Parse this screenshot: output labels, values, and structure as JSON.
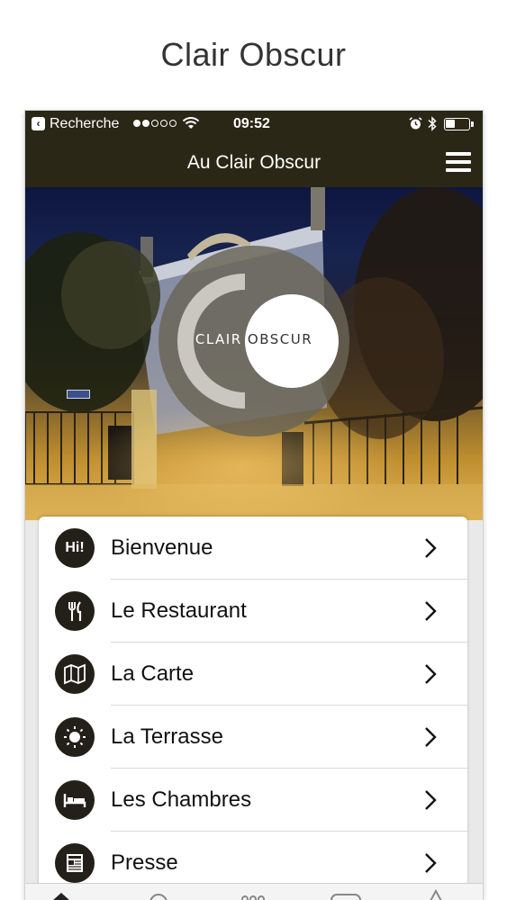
{
  "page": {
    "title": "Clair Obscur"
  },
  "statusbar": {
    "back_label": "Recherche",
    "signal": {
      "filled": 2,
      "total": 5
    },
    "time": "09:52",
    "battery_level": 0.4
  },
  "navbar": {
    "title": "Au Clair Obscur"
  },
  "hero": {
    "logo_text_light": "CLAIR",
    "logo_text_dark": "OBSCUR"
  },
  "menu": {
    "items": [
      {
        "label": "Bienvenue",
        "icon": "hi-icon",
        "icon_text": "Hi!"
      },
      {
        "label": "Le Restaurant",
        "icon": "fork-knife-icon"
      },
      {
        "label": "La Carte",
        "icon": "map-icon"
      },
      {
        "label": "La Terrasse",
        "icon": "sun-icon"
      },
      {
        "label": "Les Chambres",
        "icon": "bed-icon"
      },
      {
        "label": "Presse",
        "icon": "newspaper-icon"
      }
    ]
  },
  "colors": {
    "bar_background": "#2a2716",
    "icon_circle": "#23201a",
    "card": "#ffffff"
  }
}
